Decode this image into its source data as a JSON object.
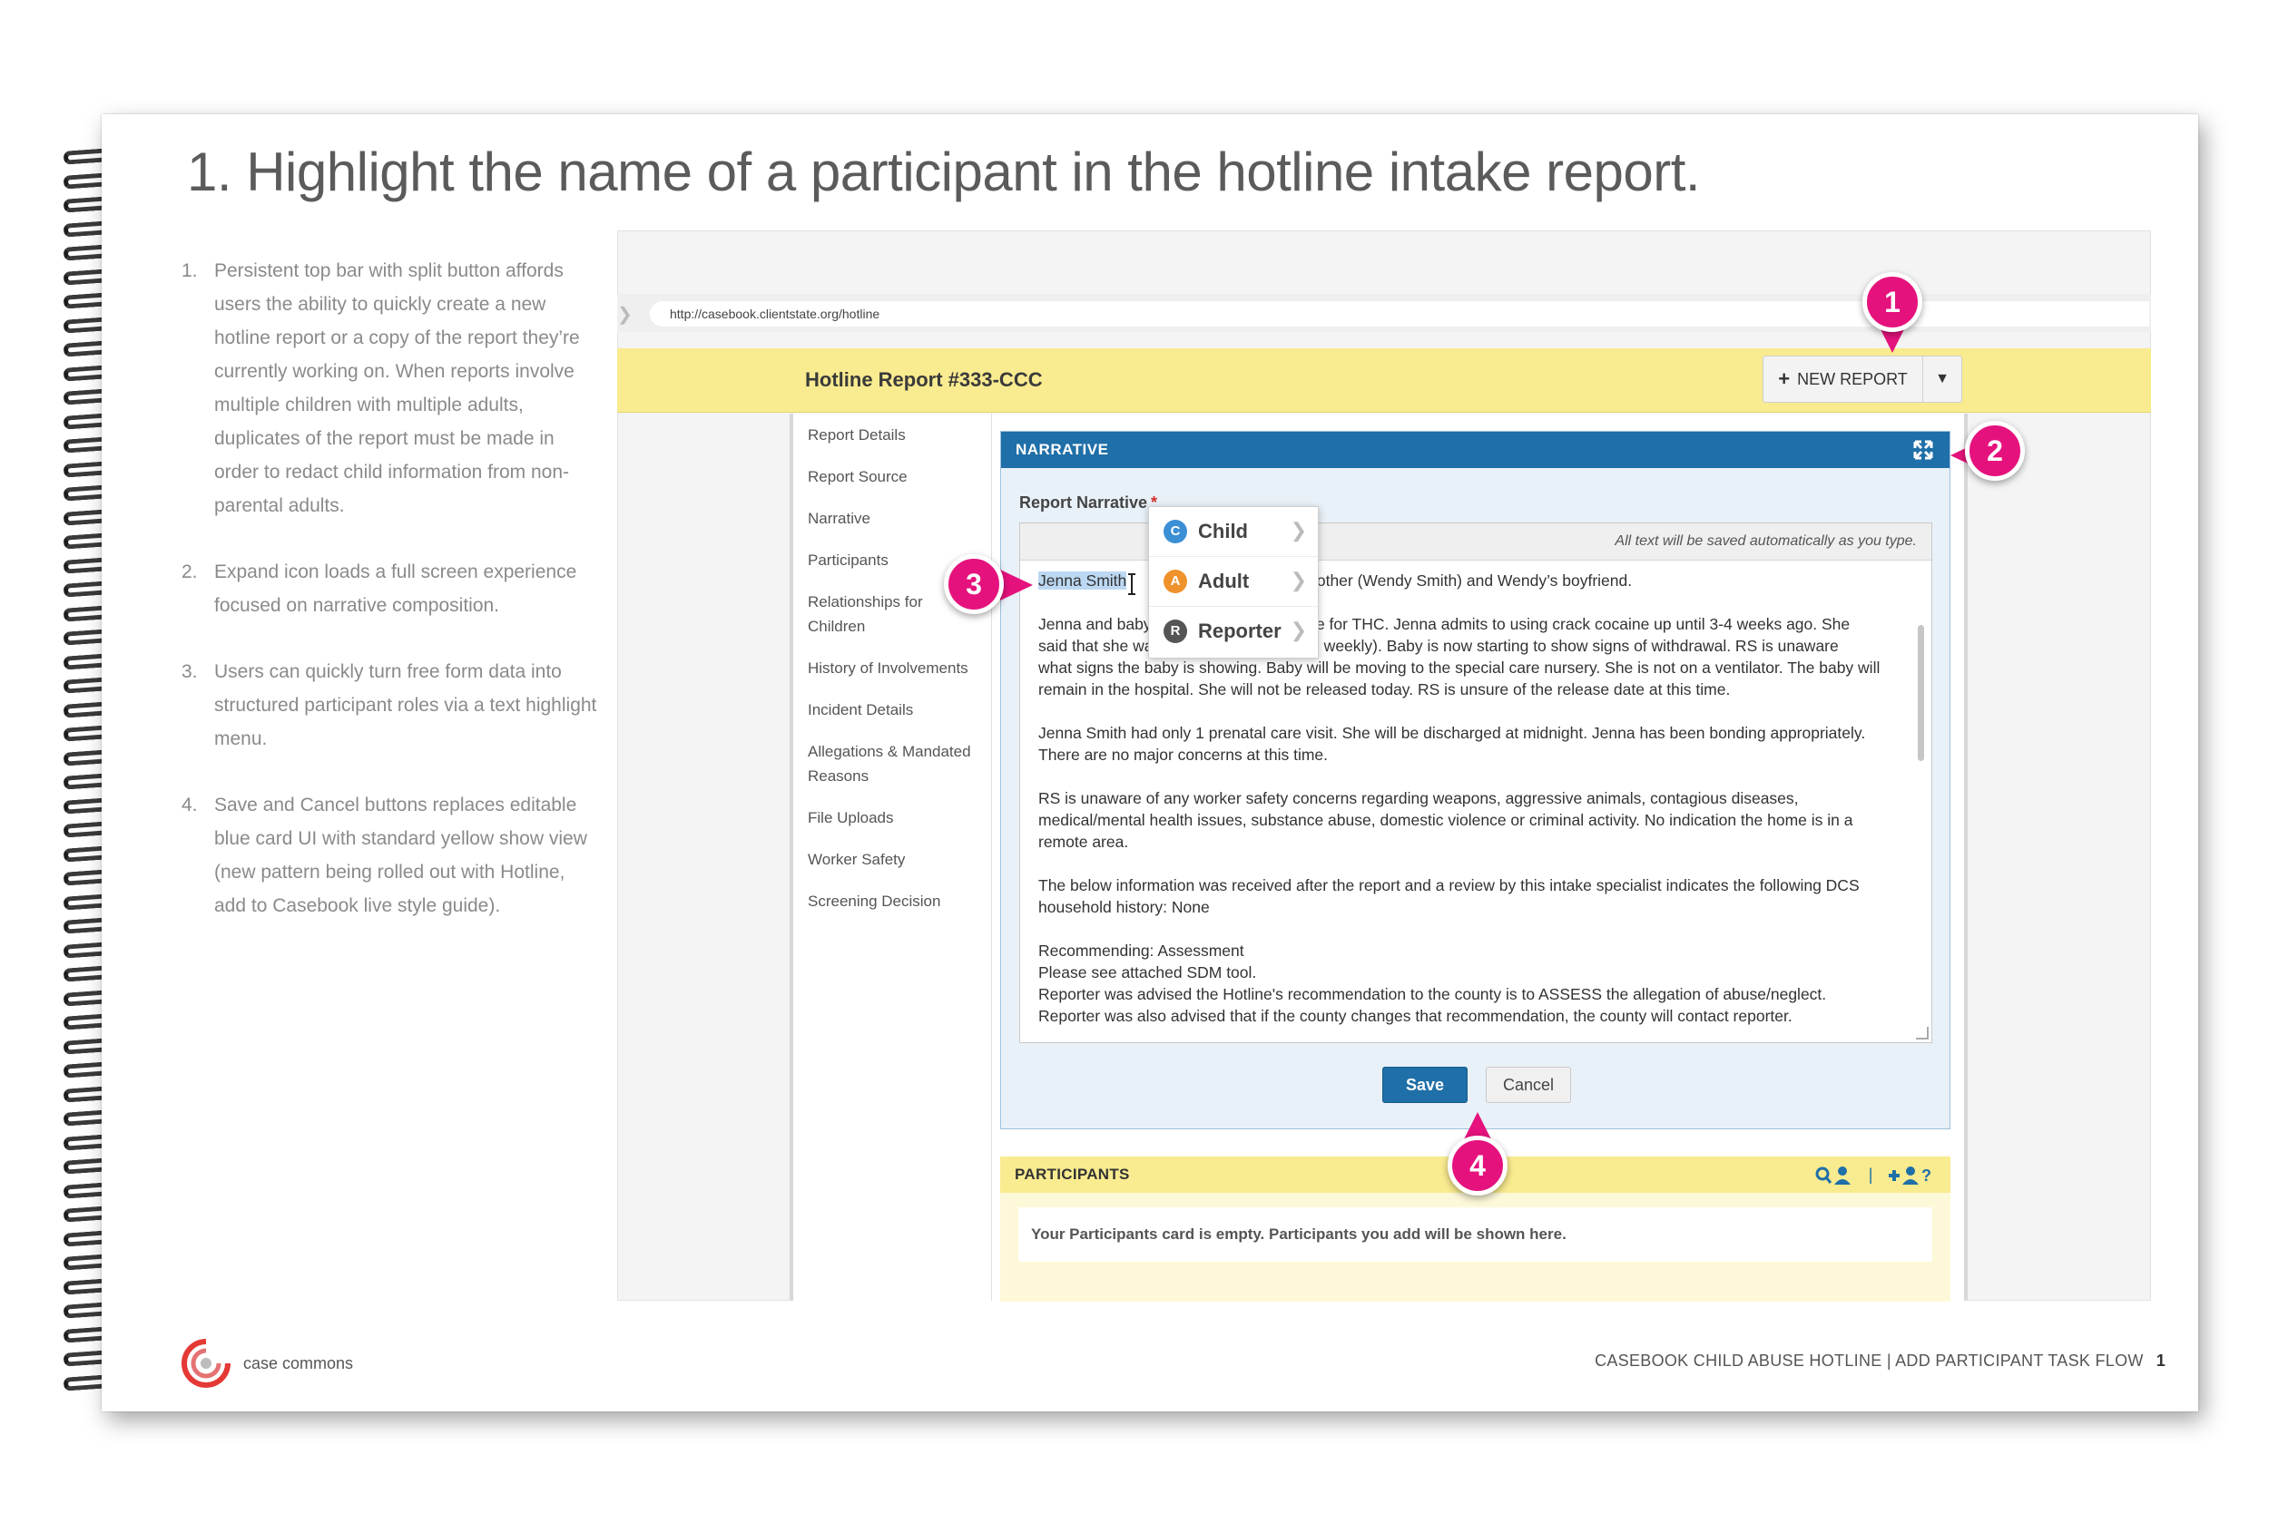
{
  "page": {
    "title": "1. Highlight the name of a participant in the hotline intake report."
  },
  "notes": [
    {
      "num": "1.",
      "text": "Persistent top bar with split button affords users the ability to quickly create a new hotline report or a copy of the report they’re currently working on. When reports involve multiple children with multiple adults, duplicates of the report must be made in order to redact child information from non-parental adults."
    },
    {
      "num": "2.",
      "text": "Expand icon loads a full screen experience focused on narrative composition."
    },
    {
      "num": "3.",
      "text": "Users can quickly turn free form data into structured participant roles via a text highlight menu."
    },
    {
      "num": "4.",
      "text": "Save and Cancel buttons replaces editable blue card UI with standard yellow show view (new pattern being rolled out with Hotline, add to Casebook live style guide)."
    }
  ],
  "brand": {
    "text": "case commons",
    "color": "#e53935"
  },
  "footer": {
    "text": "CASEBOOK CHILD ABUSE HOTLINE | ADD PARTICIPANT TASK FLOW",
    "page_num": "1"
  },
  "browser": {
    "url": "http://casebook.clientstate.org/hotline"
  },
  "topbar": {
    "title": "Hotline Report #333-CCC",
    "new_report_label": "NEW REPORT",
    "plus_icon": "+",
    "caret_icon": "▼"
  },
  "sidenav": {
    "items": [
      "Report Details",
      "Report Source",
      "Narrative",
      "Participants",
      "Relationships for Children",
      "History of Involvements",
      "Incident Details",
      "Allegations & Mandated Reasons",
      "File Uploads",
      "Worker Safety",
      "Screening Decision"
    ]
  },
  "narrative": {
    "header": "NARRATIVE",
    "label": "Report Narrative",
    "required": "*",
    "autosave": "All text will be saved automatically as you type.",
    "highlighted": "Jenna Smith",
    "line1_rest": "mother (Wendy Smith) and Wendy’s boyfriend.",
    "p2_line1_start": "Jenna and baby",
    "p2_line1_end": "itive for THC. Jenna admits to using crack cocaine up until 3-4 weeks ago. She",
    "p2_line2_start": "said that she wa",
    "p2_line2_end": "aid weekly). Baby is now starting to show signs of withdrawal. RS is unaware",
    "p2_line3": "what signs the baby is showing. Baby will be moving to the special care nursery. She is not on a ventilator. The baby will remain in the hospital. She will not be released today. RS is unsure of the release date at this time.",
    "p3": "Jenna Smith had only 1 prenatal care visit. She will be discharged at midnight. Jenna has been bonding appropriately. There are no major concerns at this time.",
    "p4": "RS is unaware of any worker safety concerns regarding weapons, aggressive animals, contagious diseases, medical/mental health issues, substance abuse, domestic violence or criminal activity. No indication the home is in a remote area.",
    "p5": "The below information was received after the report and a review by this intake specialist indicates the following DCS household history: None",
    "p6_l1": "Recommending: Assessment",
    "p6_l2": "Please see attached SDM tool.",
    "p6_l3": "Reporter was advised the Hotline's recommendation to the county is to ASSESS the allegation of abuse/neglect.",
    "p6_l4": "Reporter was also advised that if the county changes that recommendation, the county will contact reporter.",
    "save": "Save",
    "cancel": "Cancel"
  },
  "popup": {
    "items": [
      {
        "badge": "C",
        "label": "Child",
        "color": "#3b8fd4"
      },
      {
        "badge": "A",
        "label": "Adult",
        "color": "#f0922b"
      },
      {
        "badge": "R",
        "label": "Reporter",
        "color": "#555555"
      }
    ]
  },
  "participants": {
    "header": "PARTICIPANTS",
    "empty": "Your Participants card is empty. Participants you add will be shown here.",
    "icons": [
      "search-person-icon",
      "add-person-icon"
    ]
  },
  "callouts": [
    "1",
    "2",
    "3",
    "4"
  ],
  "colors": {
    "callout": "#e5127d",
    "topbar": "#f9eb8f",
    "card_head": "#1f6fa8"
  }
}
